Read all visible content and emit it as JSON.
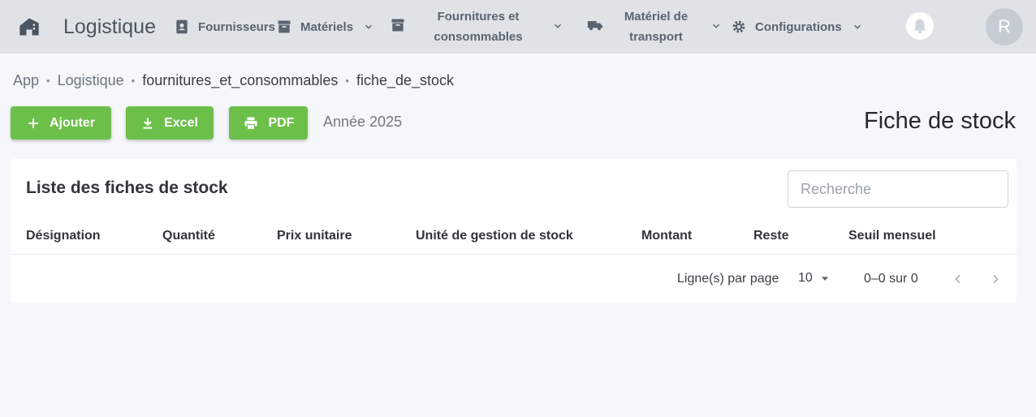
{
  "app": {
    "brand": "Logistique",
    "nav": {
      "suppliers": "Fournisseurs",
      "materials": "Matériels",
      "supplies_line1": "Fournitures et",
      "supplies_line2": "consommables",
      "transport_line1": "Matériel de",
      "transport_line2": "transport",
      "settings": "Configurations"
    },
    "user_initial": "R"
  },
  "breadcrumb": [
    "App",
    "Logistique",
    "fournitures_et_consommables",
    "fiche_de_stock"
  ],
  "breadcrumb_separator": "•",
  "toolbar": {
    "add_label": "Ajouter",
    "excel_label": "Excel",
    "pdf_label": "PDF",
    "year_label": "Année 2025"
  },
  "page_title": "Fiche de stock",
  "table": {
    "title": "Liste des fiches de stock",
    "search_placeholder": "Recherche",
    "columns": [
      "Désignation",
      "Quantité",
      "Prix unitaire",
      "Unité de gestion de stock",
      "Montant",
      "Reste",
      "Seuil mensuel"
    ],
    "rows": []
  },
  "pagination": {
    "rows_per_page_label": "Ligne(s) par page",
    "rows_per_page_value": "10",
    "range_text": "0–0 sur 0"
  },
  "colors": {
    "accent_green": "#6cc04a",
    "topbar_bg": "#dfe3e8",
    "page_bg": "#f5f7fa"
  },
  "icons": [
    "home-icon",
    "contacts-icon",
    "archive-icon",
    "truck-icon",
    "gear-icon",
    "bell-icon",
    "chevron-down-icon",
    "plus-icon",
    "download-icon",
    "printer-icon",
    "caret-down-icon",
    "chevron-left-icon",
    "chevron-right-icon"
  ]
}
